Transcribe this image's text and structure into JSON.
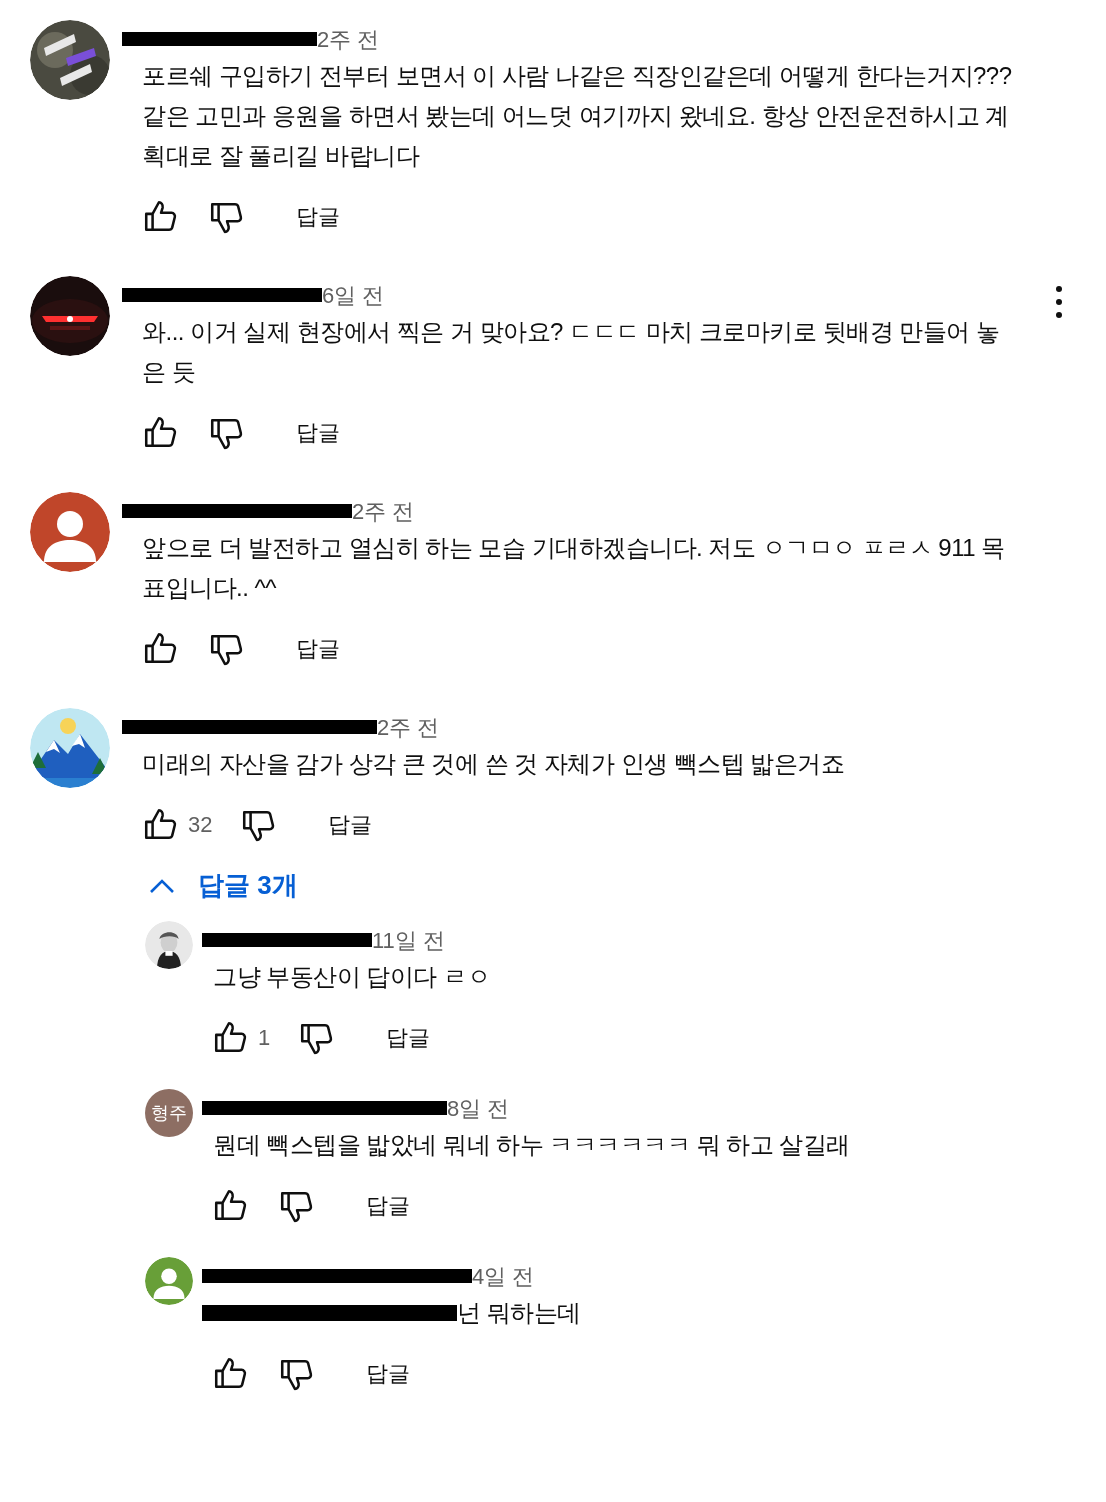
{
  "comments": [
    {
      "time": "2주 전",
      "text": "포르쉐 구입하기 전부터 보면서 이 사람 나같은 직장인같은데 어떻게 한다는거지??? 같은 고민과 응원을 하면서 봤는데 어느덧 여기까지 왔네요. 항상 안전운전하시고 계획대로 잘 풀리길 바랍니다",
      "reply_label": "답글",
      "menu_visible": false
    },
    {
      "time": "6일 전",
      "text": "와... 이거 실제 현장에서 찍은 거 맞아요? ㄷㄷㄷ 마치 크로마키로 뒷배경 만들어 놓은 듯",
      "reply_label": "답글",
      "menu_visible": true
    },
    {
      "avatar": {
        "kind": "silhouette",
        "color": "#c0462a"
      },
      "time": "2주 전",
      "text": "앞으로 더 발전하고  열심히 하는 모습 기대하겠습니다. 저도 ㅇㄱㅁㅇ ㅍㄹㅅ 911 목표입니다.. ^^",
      "reply_label": "답글",
      "menu_visible": false
    },
    {
      "avatar": {
        "kind": "mountain"
      },
      "time": "2주 전",
      "text": "미래의 자산을 감가 상각 큰 것에 쓴 것 자체가 인생 빽스텝 밟은거죠",
      "likes": "32",
      "reply_label": "답글",
      "menu_visible": false,
      "replies_toggle": {
        "label": "답글 3개",
        "expanded": true
      },
      "replies": [
        {
          "time": "11일 전",
          "text": "그냥 부동산이 답이다 ㄹㅇ",
          "likes": "1",
          "reply_label": "답글",
          "has_redacted_mention": false
        },
        {
          "avatar": {
            "kind": "initials",
            "initials": "형주",
            "color": "#8d6e63"
          },
          "time": "8일 전",
          "text": "뭔데 빽스텝을 밟았네 뭐네 하누 ㅋㅋㅋㅋㅋㅋ 뭐 하고 살길래",
          "reply_label": "답글",
          "has_redacted_mention": false
        },
        {
          "avatar": {
            "kind": "silhouette",
            "color": "#689f38"
          },
          "time": "4일 전",
          "text": "넌 뭐하는데",
          "reply_label": "답글",
          "has_redacted_mention": true
        }
      ]
    }
  ]
}
